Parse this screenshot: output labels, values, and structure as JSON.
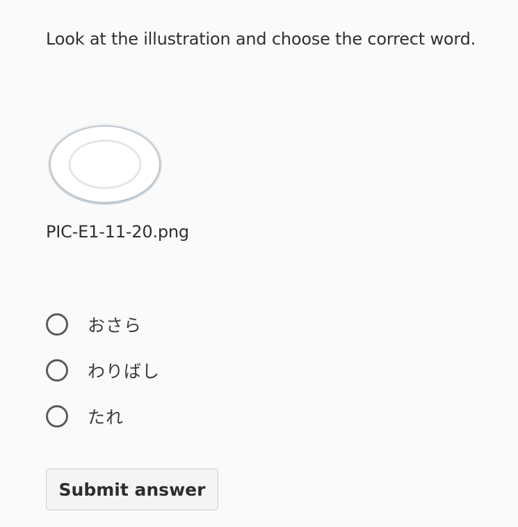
{
  "question": {
    "prompt": "Look at the illustration and choose the correct word."
  },
  "illustration": {
    "icon": "plate-icon",
    "filename": "PIC-E1-11-20.png"
  },
  "options": [
    {
      "label": "おさら",
      "selected": false
    },
    {
      "label": "わりばし",
      "selected": false
    },
    {
      "label": "たれ",
      "selected": false
    }
  ],
  "submit": {
    "label": "Submit answer"
  }
}
